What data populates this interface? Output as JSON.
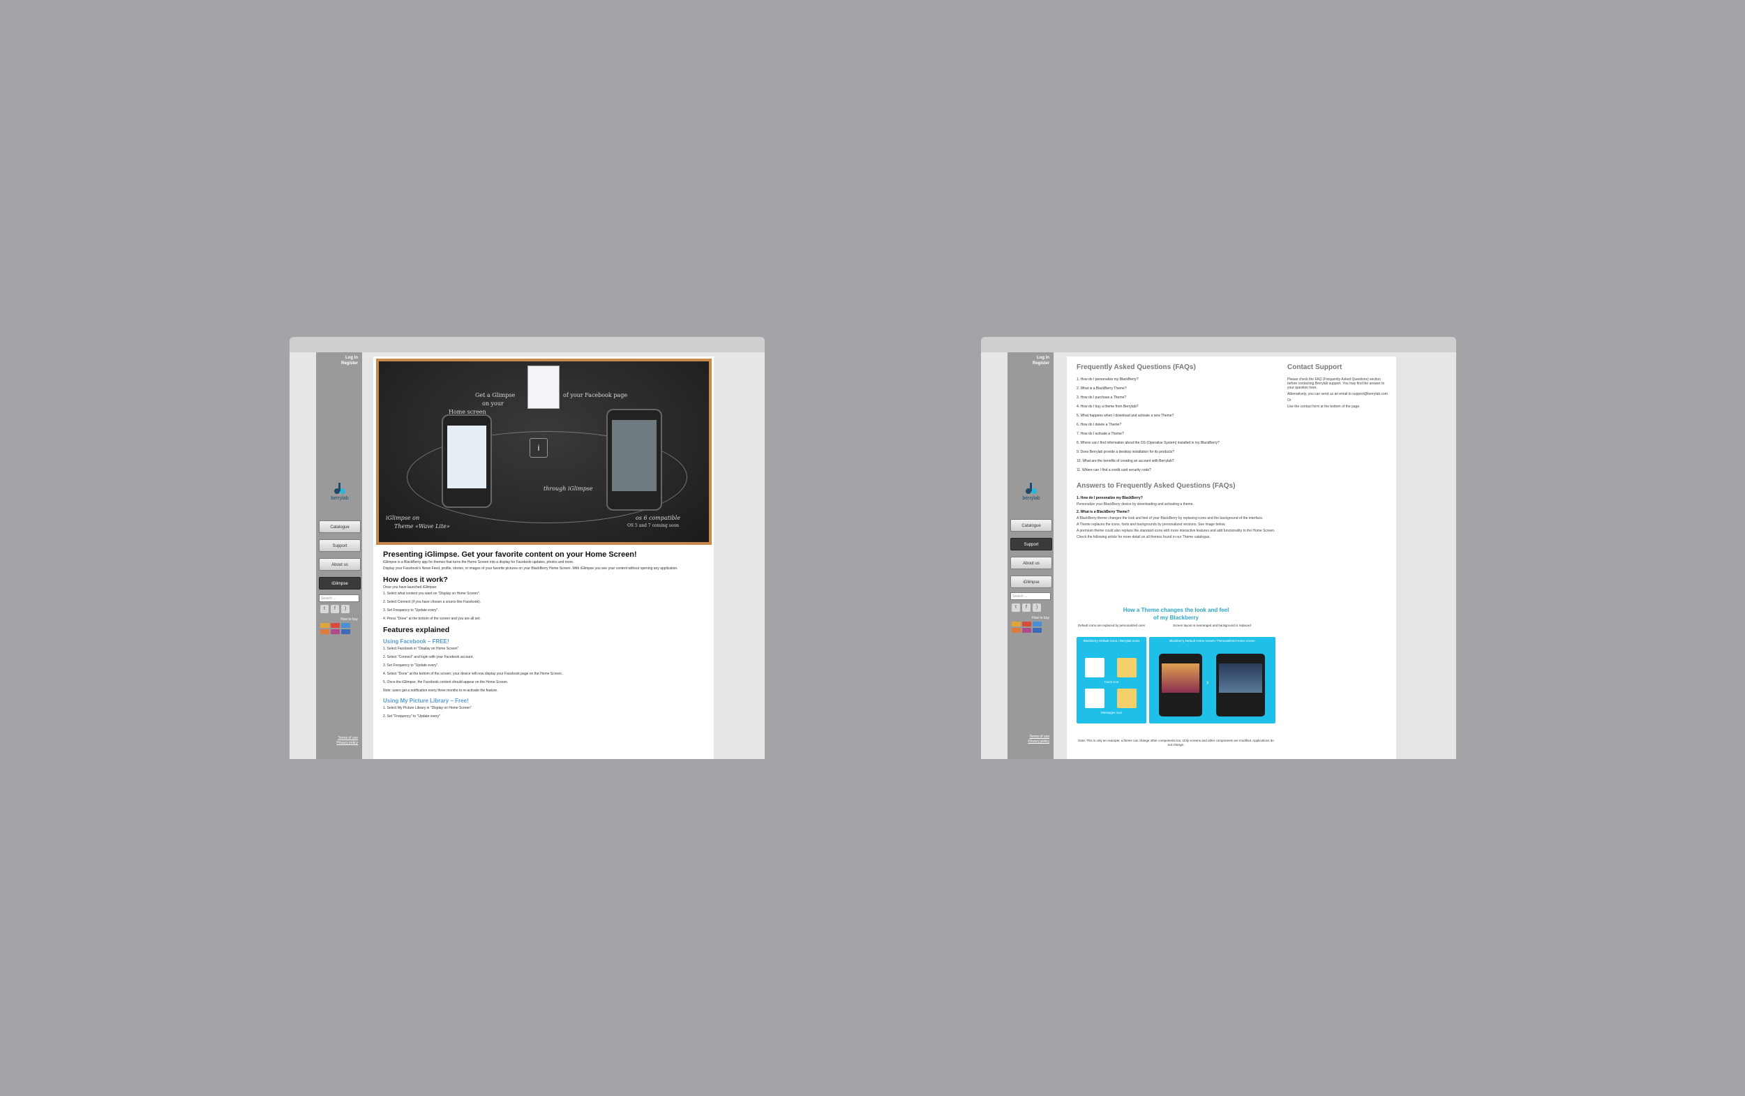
{
  "left": {
    "login": "Log In",
    "register": "Register",
    "logo_text": "berrylab",
    "nav": [
      "Catalogue",
      "Support",
      "About us",
      "iGlimpse"
    ],
    "active_nav": 3,
    "search_placeholder": "Search ...",
    "how_to_buy": "How to buy",
    "terms": "Terms of use",
    "privacy": "Privacy policy",
    "hero": {
      "line1": "Get a Glimpse",
      "line2": "on your",
      "line3": "Home screen",
      "line4": "of your Facebook page",
      "through": "through iGlimpse",
      "footer_left1": "iGlimpse on",
      "footer_left2": "Theme «Wave Lite»",
      "footer_right1": "os 6 compatible",
      "footer_right2": "OS 5 and 7 coming soon"
    },
    "headline": "Presenting iGlimpse. Get your favorite content on your Home Screen!",
    "intro1": "iGlimpse is a BlackBerry app for themes that turns the Home Screen into a display for Facebook updates, photos and more.",
    "intro2": "Display your Facebook's News Feed, profile, stories, or images of your favorite pictures on your BlackBerry Home Screen. With iGlimpse you see your content without opening any application.",
    "how_title": "How does it work?",
    "how_intro": "Once you have launched iGlimpse:",
    "steps": [
      "1. Select what content you want on \"Display on Home Screen\".",
      "2. Select Connect (if you have chosen a source like Facebook).",
      "3. Set Frequency to \"Update every\".",
      "4. Press \"Done\" at the bottom of the screen and you are all set."
    ],
    "features_title": "Features explained",
    "fb_title": "Using Facebook – FREE!",
    "fb_steps": [
      "1. Select Facebook in \"Display on Home Screen\".",
      "2. Select \"Connect\" and login with your Facebook account.",
      "3. Set Frequency to \"Update every\".",
      "4. Select \"Done\" at the bottom of the screen; your device will now display your Facebook page on the Home Screen.",
      "5. Once the iGlimpse, the Facebook content should appear on the Home Screen."
    ],
    "fb_note": "Note: users get a notification every three months to re-activate the feature.",
    "pic_title": "Using My Picture Library – Free!",
    "pic_steps": [
      "1. Select My Picture Library in \"Display on Home Screen\"",
      "2. Set \"Frequency\" to \"Update every\""
    ]
  },
  "right": {
    "login": "Log In",
    "register": "Register",
    "logo_text": "berrylab",
    "nav": [
      "Catalogue",
      "Support",
      "About us",
      "iGlimpse"
    ],
    "active_nav": 1,
    "search_placeholder": "Search ...",
    "how_to_buy": "How to buy",
    "terms": "Terms of use",
    "privacy": "Privacy policy",
    "faq_title": "Frequently Asked Questions (FAQs)",
    "faq_items": [
      "1. How do I personalize my BlackBerry?",
      "2. What is a BlackBerry Theme?",
      "3. How do I purchase a Theme?",
      "4. How do I buy a theme from Berrylab?",
      "5. What happens when I download and activate a new Theme?",
      "6. How do I delete a Theme?",
      "7. How do I activate a Theme?",
      "8. Where can I find information about the OS (Operative System) installed in my BlackBerry?",
      "9. Does Berrylab provide a desktop installation for its products?",
      "10. What are the benefits of creating an account with Berrylab?",
      "11. Where can I find a credit card security code?"
    ],
    "answers_title": "Answers to Frequently Asked Questions (FAQs)",
    "answers": [
      {
        "q": "1. How do I personalize my BlackBerry?",
        "a": "Personalize your BlackBerry device by downloading and activating a theme."
      },
      {
        "q": "2. What is a BlackBerry Theme?",
        "a": "A BlackBerry theme changes the look and feel of your BlackBerry by replacing icons and the background of the interface."
      },
      {
        "q": "",
        "a": "A Theme replaces the icons, fonts and backgrounds by personalized versions. See image below."
      },
      {
        "q": "",
        "a": "A premium theme could also replace the standard icons with more interactive features and add functionality to the Home Screen."
      },
      {
        "q": "",
        "a": "Check the following article for more detail on all themes found in our Theme catalogue."
      }
    ],
    "theme_title1": "How a Theme changes the look and feel",
    "theme_title2": "of my Blackberry",
    "theme_sub_left": "Default icons are replaced by personalized ones",
    "theme_sub_right": "Screen layout is rearranged and background is replaced",
    "box1_label": "Blackberry Default icons / Berrylab icons",
    "box2_label": "Blackberry Default Home screen / Personalized Home screen",
    "icon_label1": "Clock icon",
    "icon_label2": "Messages icon",
    "caption": "Note: This is only an example; a theme can change other components too. Only screens and other components are modified. Applications do not change.",
    "contact_title": "Contact Support",
    "contact_p1": "Please check the FAQ (Frequently Asked Questions) section before contacting Berrylab support. You may find the answer to your question here.",
    "contact_p2": "Alternatively, you can send us an email to support@berrylab.com",
    "contact_p3": "Or",
    "contact_p4": "Use the contact form at the bottom of the page."
  },
  "colors": {
    "background": "#a3a4a8",
    "sidebar": "#9a9a9a",
    "accent": "#1ec0ea",
    "link": "#5b9bd5",
    "hero_frame": "#c8894a"
  }
}
